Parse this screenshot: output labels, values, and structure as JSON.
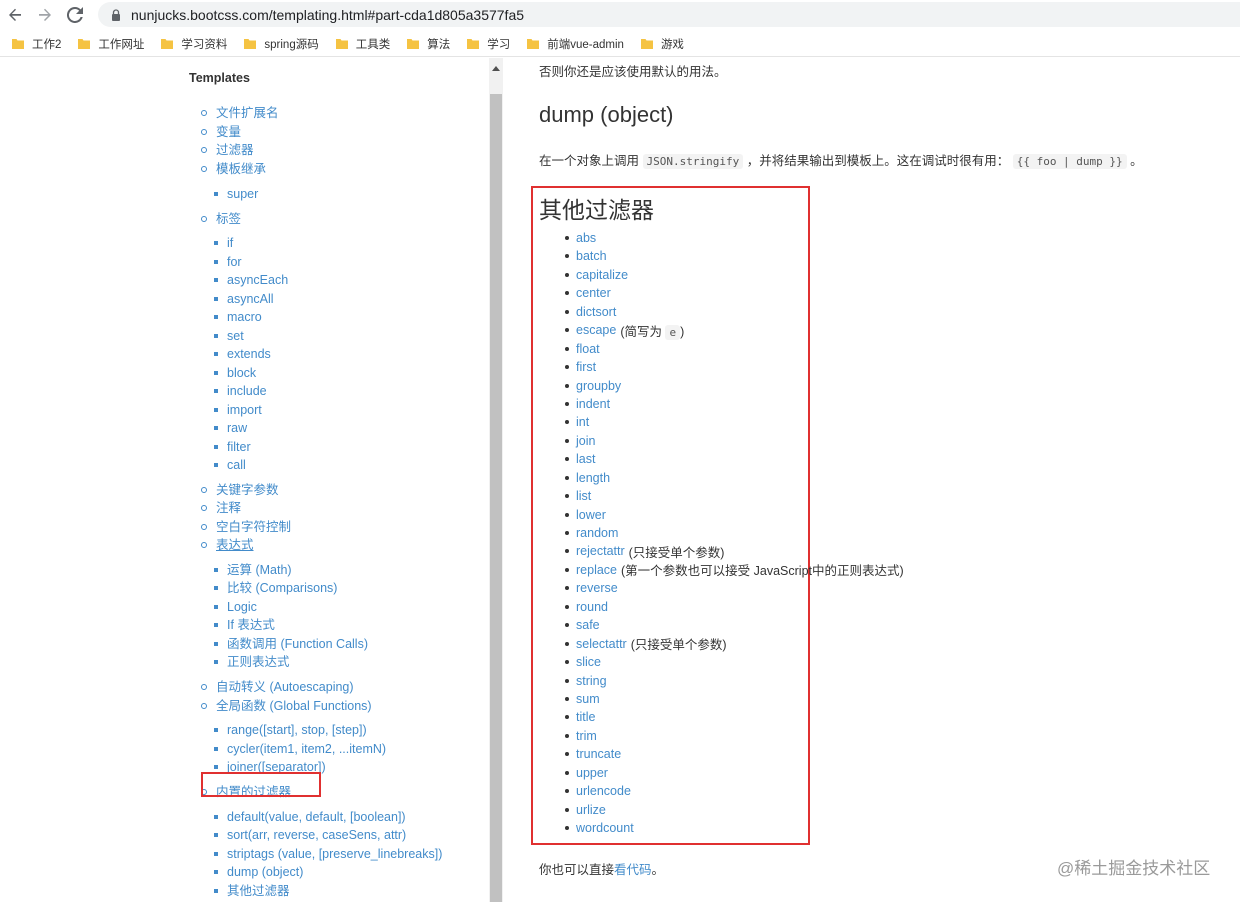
{
  "browser": {
    "url": "nunjucks.bootcss.com/templating.html#part-cda1d805a3577fa5",
    "bookmarks": [
      "工作2",
      "工作网址",
      "学习资料",
      "spring源码",
      "工具类",
      "算法",
      "学习",
      "前端vue-admin",
      "游戏"
    ]
  },
  "sidebar": {
    "title": "Templates",
    "items": [
      {
        "label": "文件扩展名",
        "level": 1
      },
      {
        "label": "变量",
        "level": 1
      },
      {
        "label": "过滤器",
        "level": 1
      },
      {
        "label": "模板继承",
        "level": 1
      },
      {
        "label": "super",
        "level": 2
      },
      {
        "label": "标签",
        "level": 1
      },
      {
        "label": "if",
        "level": 2
      },
      {
        "label": "for",
        "level": 2
      },
      {
        "label": "asyncEach",
        "level": 2
      },
      {
        "label": "asyncAll",
        "level": 2
      },
      {
        "label": "macro",
        "level": 2
      },
      {
        "label": "set",
        "level": 2
      },
      {
        "label": "extends",
        "level": 2
      },
      {
        "label": "block",
        "level": 2
      },
      {
        "label": "include",
        "level": 2
      },
      {
        "label": "import",
        "level": 2
      },
      {
        "label": "raw",
        "level": 2
      },
      {
        "label": "filter",
        "level": 2
      },
      {
        "label": "call",
        "level": 2
      },
      {
        "label": "关键字参数",
        "level": 1
      },
      {
        "label": "注释",
        "level": 1
      },
      {
        "label": "空白字符控制",
        "level": 1
      },
      {
        "label": "表达式",
        "level": 1,
        "underline": true
      },
      {
        "label": "运算 (Math)",
        "level": 2
      },
      {
        "label": "比较 (Comparisons)",
        "level": 2
      },
      {
        "label": "Logic",
        "level": 2
      },
      {
        "label": "If 表达式",
        "level": 2
      },
      {
        "label": "函数调用 (Function Calls)",
        "level": 2
      },
      {
        "label": "正则表达式",
        "level": 2
      },
      {
        "label": "自动转义 (Autoescaping)",
        "level": 1
      },
      {
        "label": "全局函数 (Global Functions)",
        "level": 1
      },
      {
        "label": "range([start], stop, [step])",
        "level": 2
      },
      {
        "label": "cycler(item1, item2, ...itemN)",
        "level": 2
      },
      {
        "label": "joiner([separator])",
        "level": 2
      },
      {
        "label": "内置的过滤器",
        "level": 1,
        "highlighted": true
      },
      {
        "label": "default(value, default, [boolean])",
        "level": 2
      },
      {
        "label": "sort(arr, reverse, caseSens, attr)",
        "level": 2
      },
      {
        "label": "striptags (value, [preserve_linebreaks])",
        "level": 2
      },
      {
        "label": "dump (object)",
        "level": 2
      },
      {
        "label": "其他过滤器",
        "level": 2
      }
    ]
  },
  "main": {
    "intro": "否则你还是应该使用默认的用法。",
    "dump_heading": "dump (object)",
    "dump_desc_before": "在一个对象上调用",
    "dump_code1": "JSON.stringify",
    "dump_desc_mid": "，并将结果输出到模板上。这在调试时很有用：",
    "dump_code2": "{{ foo | dump }}",
    "dump_desc_after": "。",
    "other_heading": "其他过滤器",
    "filters": [
      {
        "name": "abs"
      },
      {
        "name": "batch"
      },
      {
        "name": "capitalize"
      },
      {
        "name": "center"
      },
      {
        "name": "dictsort"
      },
      {
        "name": "escape",
        "note": "(简写为",
        "code": "e",
        "note_end": ")"
      },
      {
        "name": "float"
      },
      {
        "name": "first"
      },
      {
        "name": "groupby"
      },
      {
        "name": "indent"
      },
      {
        "name": "int"
      },
      {
        "name": "join"
      },
      {
        "name": "last"
      },
      {
        "name": "length"
      },
      {
        "name": "list"
      },
      {
        "name": "lower"
      },
      {
        "name": "random"
      },
      {
        "name": "rejectattr",
        "note": "(只接受单个参数)"
      },
      {
        "name": "replace",
        "note": "(第一个参数也可以接受 JavaScript中的正则表达式)"
      },
      {
        "name": "reverse"
      },
      {
        "name": "round"
      },
      {
        "name": "safe"
      },
      {
        "name": "selectattr",
        "note": "(只接受单个参数)"
      },
      {
        "name": "slice"
      },
      {
        "name": "string"
      },
      {
        "name": "sum"
      },
      {
        "name": "title"
      },
      {
        "name": "trim"
      },
      {
        "name": "truncate"
      },
      {
        "name": "upper"
      },
      {
        "name": "urlencode"
      },
      {
        "name": "urlize"
      },
      {
        "name": "wordcount"
      }
    ],
    "footer_before": "你也可以直接",
    "footer_link": "看代码",
    "footer_after": "。"
  },
  "watermark": "@稀土掘金技术社区",
  "colors": {
    "link": "#428bca",
    "highlight": "#e03030"
  }
}
